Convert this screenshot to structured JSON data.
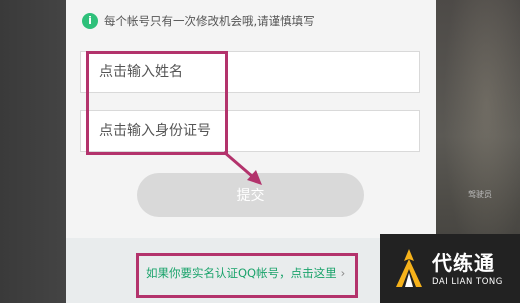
{
  "notice": {
    "icon": "info-icon",
    "icon_glyph": "i",
    "text": "每个帐号只有一次修改机会哦,请谨慎填写"
  },
  "form": {
    "name_placeholder": "点击输入姓名",
    "id_placeholder": "点击输入身份证号",
    "submit_label": "提交"
  },
  "footer": {
    "realname_link": "如果你要实名认证QQ帐号，点击这里",
    "chevron": "›"
  },
  "backdrop": {
    "caption": "驾驶员"
  },
  "watermark": {
    "name_cn": "代练通",
    "name_en": "DAI LIAN TONG"
  },
  "colors": {
    "accent_green": "#2ec07a",
    "link_green": "#1aa36b",
    "highlight": "#b3336c",
    "submit_disabled": "#d9d9d9"
  }
}
